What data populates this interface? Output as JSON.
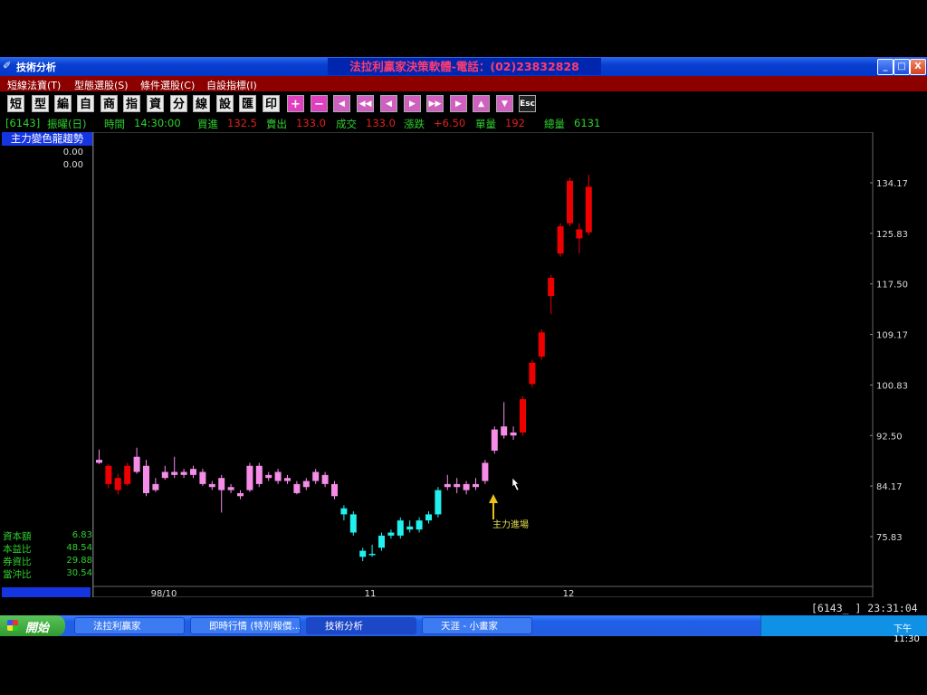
{
  "window": {
    "title": "技術分析",
    "center_title": "法拉利贏家決策軟體-電話：(02)23832828",
    "btn_min": "_",
    "btn_max": "□",
    "btn_close": "X"
  },
  "menu": [
    "短線法寶(T)",
    "型態選股(S)",
    "條件選股(C)",
    "自設指標(I)"
  ],
  "toolbar": {
    "chars": [
      "短",
      "型",
      "編",
      "自",
      "商",
      "指",
      "資",
      "分",
      "線",
      "設",
      "匯",
      "印"
    ],
    "actions": [
      "+",
      "−",
      "◀",
      "◀◀",
      "◀",
      "▶",
      "▶▶",
      "▶",
      "▲",
      "▼"
    ],
    "esc": "Esc"
  },
  "info": {
    "code": "[6143]",
    "name": "振曜(日)",
    "time_label": "時間",
    "time": "14:30:00",
    "buy_label": "買進",
    "buy": "132.5",
    "sell_label": "賣出",
    "sell": "133.0",
    "deal_label": "成交",
    "deal": "133.0",
    "change_label": "漲跌",
    "change": "+6.50",
    "vol_label": "單量",
    "vol": "192",
    "total_label": "總量",
    "total": "6131"
  },
  "left_panel": {
    "indicator": "主力變色龍趨勢",
    "values": [
      "0.00",
      "0.00"
    ],
    "stats": [
      {
        "label": "資本額",
        "value": "6.83"
      },
      {
        "label": "本益比",
        "value": "48.54"
      },
      {
        "label": "券資比",
        "value": "29.88"
      },
      {
        "label": "當沖比",
        "value": "30.54"
      }
    ]
  },
  "chart_data": {
    "type": "candlestick",
    "y_ticks": [
      "134.17",
      "125.83",
      "117.50",
      "109.17",
      "100.83",
      "92.50",
      "84.17",
      "75.83"
    ],
    "y_tick_values": [
      134.17,
      125.83,
      117.5,
      109.17,
      100.83,
      92.5,
      84.17,
      75.83
    ],
    "x_ticks": [
      "98/10",
      "11",
      "12"
    ],
    "annotation": "主力進場",
    "candles": [
      {
        "o": 88.5,
        "c": 88.0,
        "h": 90.2,
        "l": 87.8,
        "col": "pink"
      },
      {
        "o": 87.5,
        "c": 84.5,
        "h": 87.8,
        "l": 83.8,
        "col": "red"
      },
      {
        "o": 85.5,
        "c": 83.5,
        "h": 86.2,
        "l": 82.8,
        "col": "red"
      },
      {
        "o": 84.5,
        "c": 87.5,
        "h": 88.0,
        "l": 84.2,
        "col": "red"
      },
      {
        "o": 86.5,
        "c": 89.0,
        "h": 90.5,
        "l": 86.2,
        "col": "pink"
      },
      {
        "o": 87.5,
        "c": 83.0,
        "h": 88.5,
        "l": 82.5,
        "col": "pink"
      },
      {
        "o": 84.5,
        "c": 83.5,
        "h": 85.5,
        "l": 83.2,
        "col": "pink"
      },
      {
        "o": 85.5,
        "c": 86.5,
        "h": 87.5,
        "l": 85.2,
        "col": "pink"
      },
      {
        "o": 86.0,
        "c": 86.5,
        "h": 89.0,
        "l": 85.5,
        "col": "pink"
      },
      {
        "o": 86.5,
        "c": 86.0,
        "h": 87.0,
        "l": 85.5,
        "col": "pink"
      },
      {
        "o": 86.0,
        "c": 87.0,
        "h": 87.5,
        "l": 85.5,
        "col": "pink"
      },
      {
        "o": 86.5,
        "c": 84.5,
        "h": 87.0,
        "l": 84.2,
        "col": "pink"
      },
      {
        "o": 84.5,
        "c": 84.0,
        "h": 85.0,
        "l": 83.5,
        "col": "pink"
      },
      {
        "o": 85.5,
        "c": 83.5,
        "h": 86.0,
        "l": 79.8,
        "col": "pink"
      },
      {
        "o": 84.0,
        "c": 83.5,
        "h": 84.5,
        "l": 83.0,
        "col": "pink"
      },
      {
        "o": 83.0,
        "c": 82.5,
        "h": 83.5,
        "l": 82.0,
        "col": "pink"
      },
      {
        "o": 83.5,
        "c": 87.5,
        "h": 88.0,
        "l": 83.2,
        "col": "pink"
      },
      {
        "o": 87.5,
        "c": 84.5,
        "h": 88.0,
        "l": 84.0,
        "col": "pink"
      },
      {
        "o": 85.5,
        "c": 86.0,
        "h": 86.5,
        "l": 85.0,
        "col": "pink"
      },
      {
        "o": 86.5,
        "c": 85.0,
        "h": 87.0,
        "l": 84.5,
        "col": "pink"
      },
      {
        "o": 85.5,
        "c": 85.0,
        "h": 86.0,
        "l": 84.5,
        "col": "pink"
      },
      {
        "o": 84.5,
        "c": 83.0,
        "h": 85.0,
        "l": 82.8,
        "col": "pink"
      },
      {
        "o": 84.0,
        "c": 85.0,
        "h": 85.5,
        "l": 83.5,
        "col": "pink"
      },
      {
        "o": 85.0,
        "c": 86.5,
        "h": 87.0,
        "l": 84.5,
        "col": "pink"
      },
      {
        "o": 86.0,
        "c": 84.5,
        "h": 86.5,
        "l": 84.0,
        "col": "pink"
      },
      {
        "o": 84.5,
        "c": 82.5,
        "h": 85.0,
        "l": 82.0,
        "col": "pink"
      },
      {
        "o": 80.5,
        "c": 79.5,
        "h": 81.0,
        "l": 78.5,
        "col": "cyan"
      },
      {
        "o": 79.5,
        "c": 76.5,
        "h": 80.0,
        "l": 76.0,
        "col": "cyan"
      },
      {
        "o": 73.5,
        "c": 72.5,
        "h": 74.0,
        "l": 71.8,
        "col": "cyan"
      },
      {
        "o": 73.0,
        "c": 72.8,
        "h": 74.5,
        "l": 72.5,
        "col": "cyan"
      },
      {
        "o": 74.0,
        "c": 76.0,
        "h": 76.5,
        "l": 73.5,
        "col": "cyan"
      },
      {
        "o": 76.5,
        "c": 76.0,
        "h": 77.0,
        "l": 75.5,
        "col": "cyan"
      },
      {
        "o": 78.5,
        "c": 76.0,
        "h": 79.0,
        "l": 75.5,
        "col": "cyan"
      },
      {
        "o": 77.5,
        "c": 77.0,
        "h": 78.5,
        "l": 76.5,
        "col": "cyan"
      },
      {
        "o": 78.5,
        "c": 77.0,
        "h": 79.0,
        "l": 76.5,
        "col": "cyan"
      },
      {
        "o": 79.5,
        "c": 78.5,
        "h": 80.0,
        "l": 78.0,
        "col": "cyan"
      },
      {
        "o": 83.5,
        "c": 79.5,
        "h": 84.0,
        "l": 79.0,
        "col": "cyan"
      },
      {
        "o": 84.0,
        "c": 84.5,
        "h": 86.0,
        "l": 83.5,
        "col": "pink"
      },
      {
        "o": 84.5,
        "c": 84.0,
        "h": 85.5,
        "l": 83.0,
        "col": "pink"
      },
      {
        "o": 84.5,
        "c": 83.5,
        "h": 85.0,
        "l": 82.8,
        "col": "pink"
      },
      {
        "o": 84.0,
        "c": 84.5,
        "h": 85.5,
        "l": 83.5,
        "col": "pink"
      },
      {
        "o": 85.0,
        "c": 88.0,
        "h": 88.5,
        "l": 84.5,
        "col": "pink"
      },
      {
        "o": 90.0,
        "c": 93.5,
        "h": 94.0,
        "l": 89.5,
        "col": "pink"
      },
      {
        "o": 92.5,
        "c": 94.0,
        "h": 98.0,
        "l": 92.0,
        "col": "pink"
      },
      {
        "o": 92.5,
        "c": 93.0,
        "h": 94.0,
        "l": 91.8,
        "col": "pink"
      },
      {
        "o": 93.0,
        "c": 98.5,
        "h": 99.0,
        "l": 92.5,
        "col": "red"
      },
      {
        "o": 101.0,
        "c": 104.5,
        "h": 105.0,
        "l": 100.5,
        "col": "red"
      },
      {
        "o": 105.5,
        "c": 109.5,
        "h": 110.0,
        "l": 105.0,
        "col": "red"
      },
      {
        "o": 115.5,
        "c": 118.5,
        "h": 119.0,
        "l": 112.5,
        "col": "red"
      },
      {
        "o": 122.5,
        "c": 127.0,
        "h": 127.5,
        "l": 122.0,
        "col": "red"
      },
      {
        "o": 127.5,
        "c": 134.5,
        "h": 135.0,
        "l": 127.0,
        "col": "red"
      },
      {
        "o": 126.5,
        "c": 125.0,
        "h": 127.5,
        "l": 122.5,
        "col": "red"
      },
      {
        "o": 126.0,
        "c": 133.5,
        "h": 135.5,
        "l": 125.5,
        "col": "red"
      }
    ]
  },
  "status": "[6143_ ]  23:31:04",
  "taskbar": {
    "start": "開始",
    "tasks": [
      "法拉利贏家",
      "即時行情 (特別報價...",
      "技術分析",
      "天涯 - 小畫家"
    ],
    "clock": "下午 11:30"
  }
}
